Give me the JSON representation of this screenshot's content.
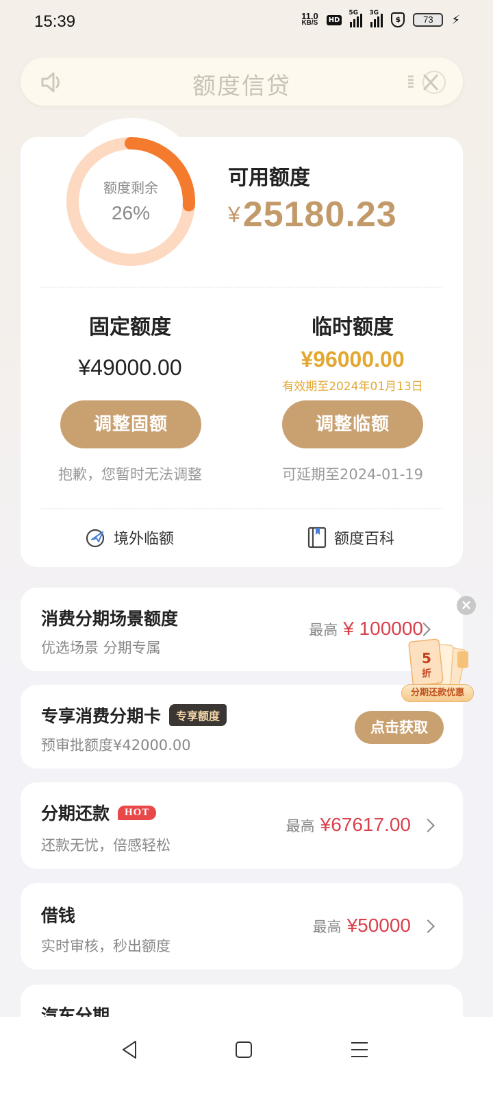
{
  "status_bar": {
    "time": "15:39",
    "net_speed_value": "11.0",
    "net_speed_unit": "KB/S",
    "hd_label": "HD",
    "signal1_label": "5G",
    "signal2_label": "3G",
    "battery": "73",
    "icons": [
      "hd-icon",
      "signal-5g-icon",
      "signal-3g-icon",
      "shield-icon",
      "battery-icon",
      "charging-icon"
    ]
  },
  "header": {
    "title": "额度信贷",
    "left_icon": "speaker-icon",
    "right_icon": "close-icon"
  },
  "quota": {
    "ring_label": "额度剩余",
    "ring_percent": "26%",
    "ring_fraction": 0.26,
    "available_label": "可用额度",
    "available_currency": "¥",
    "available_amount": "25180.23",
    "fixed_title": "固定额度",
    "fixed_amount": "¥49000.00",
    "fixed_button": "调整固额",
    "fixed_note": "抱歉，您暂时无法调整",
    "temp_title": "临时额度",
    "temp_amount": "¥96000.00",
    "temp_validity": "有效期至2024年01月13日",
    "temp_button": "调整临额",
    "temp_note": "可延期至2024-01-19",
    "link_overseas": "境外临额",
    "link_wiki": "额度百科"
  },
  "products": {
    "consume": {
      "title": "消费分期场景额度",
      "subtitle": "优选场景 分期专属",
      "prefix": "最高",
      "amount": "¥ 100000"
    },
    "card": {
      "title": "专享消费分期卡",
      "tag": "专享额度",
      "subtitle": "预审批额度¥42000.00",
      "button": "点击获取"
    },
    "installment": {
      "title": "分期还款",
      "tag": "HOT",
      "subtitle": "还款无忧，倍感轻松",
      "prefix": "最高",
      "amount": "¥67617.00"
    },
    "borrow": {
      "title": "借钱",
      "subtitle": "实时审核，秒出额度",
      "prefix": "最高",
      "amount": "¥50000"
    },
    "car": {
      "title": "汽车分期"
    }
  },
  "promo": {
    "number": "5",
    "unit": "折",
    "label": "分期还款优惠"
  },
  "colors": {
    "gold": "#c9a171",
    "ring_accent": "#f47a2e",
    "ring_track": "#fcd9c0",
    "amount_red": "#d9404b",
    "temp_gold": "#e3a832"
  }
}
